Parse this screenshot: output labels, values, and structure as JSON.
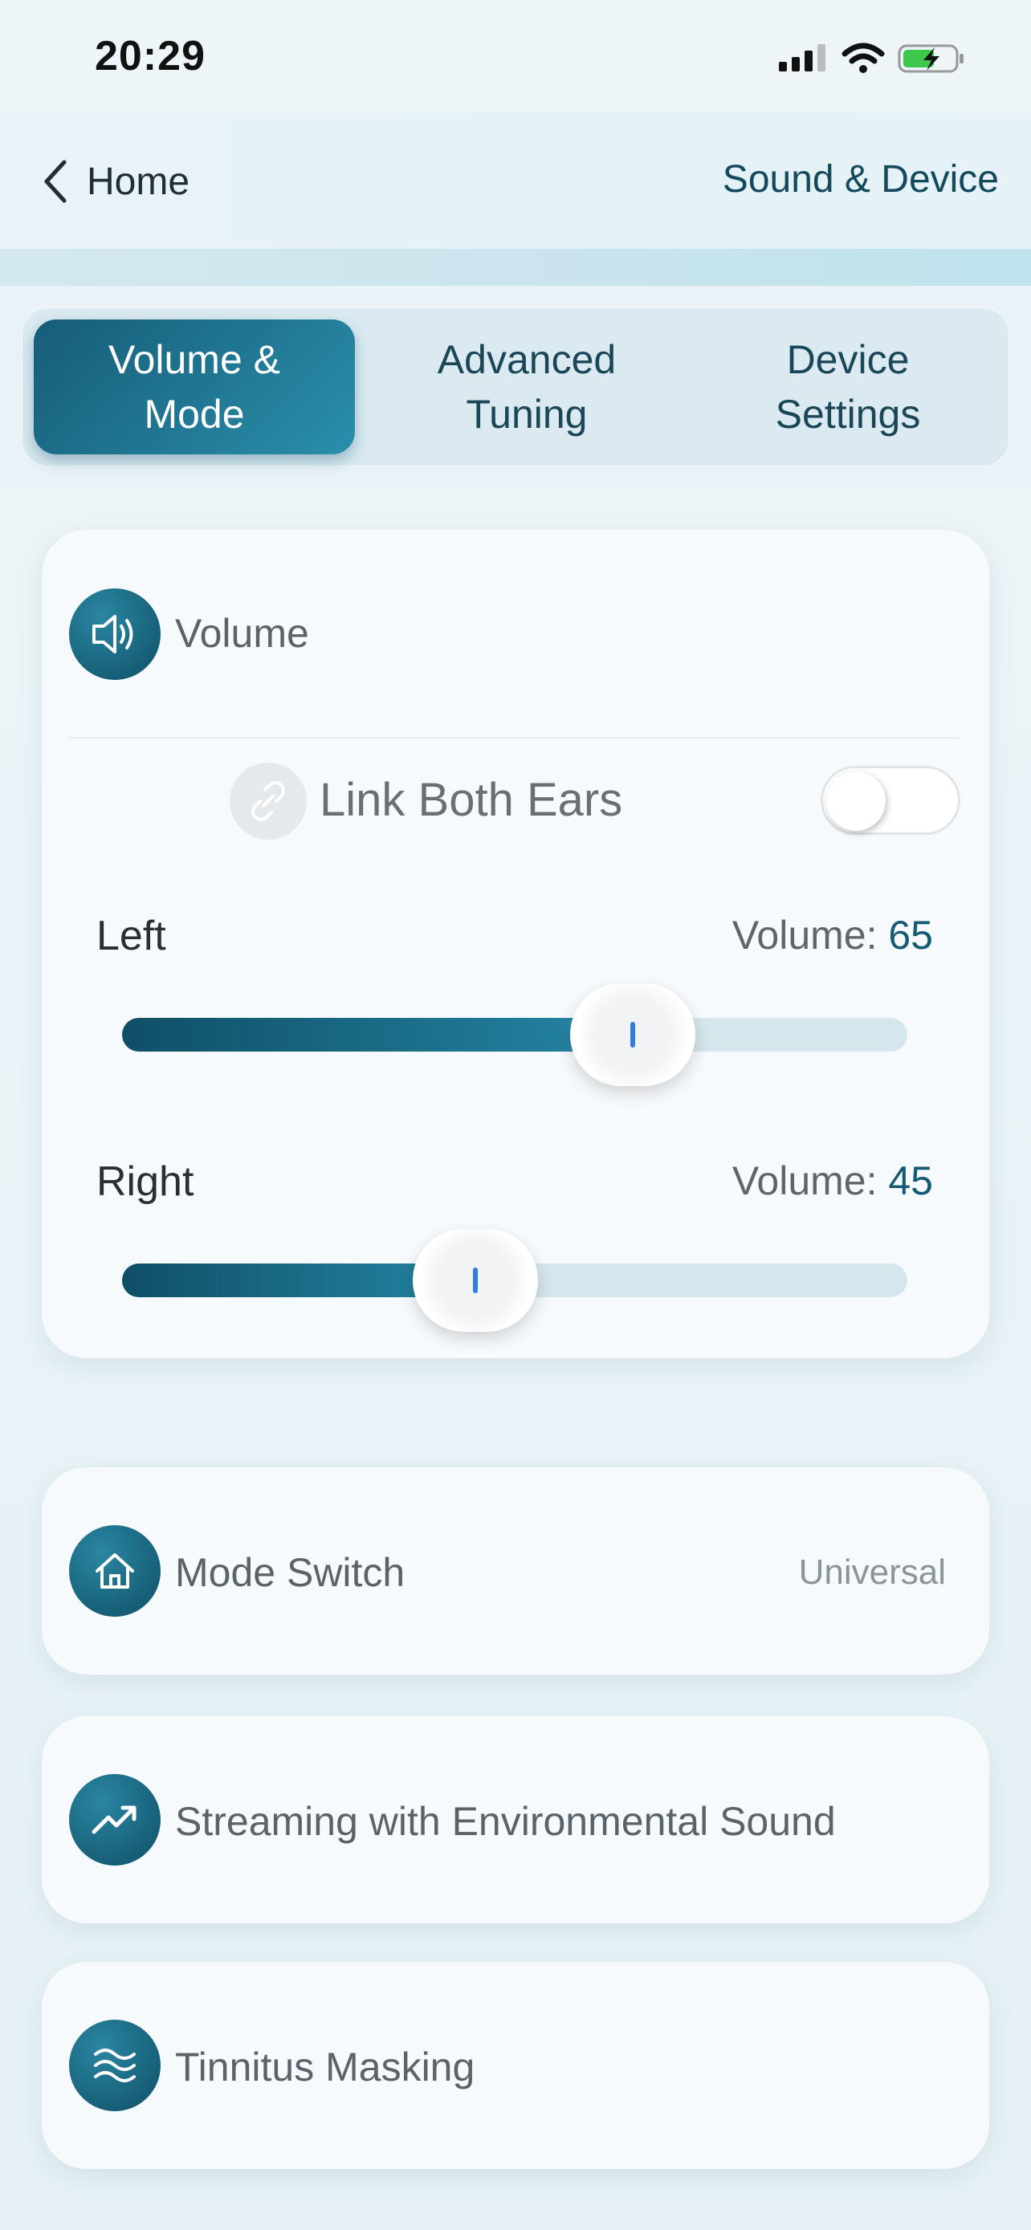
{
  "status_bar": {
    "time": "20:29",
    "battery_color": "#3cc84a"
  },
  "nav": {
    "back_label": "Home",
    "title": "Sound & Device"
  },
  "tabs": [
    {
      "label": "Volume &\nMode",
      "active": true
    },
    {
      "label": "Advanced\nTuning",
      "active": false
    },
    {
      "label": "Device\nSettings",
      "active": false
    }
  ],
  "volume_card": {
    "title": "Volume",
    "link_label": "Link Both Ears",
    "link_enabled": false,
    "left": {
      "label": "Left",
      "readout_prefix": "Volume: ",
      "value": "65",
      "level_percent": 65
    },
    "right": {
      "label": "Right",
      "readout_prefix": "Volume: ",
      "value": "45",
      "level_percent": 45
    }
  },
  "rows": {
    "mode": {
      "label": "Mode Switch",
      "value": "Universal",
      "icon": "home-icon"
    },
    "stream": {
      "label": "Streaming with Environmental Sound",
      "icon": "trend-icon"
    },
    "tinnitus": {
      "label": "Tinnitus Masking",
      "icon": "waves-icon"
    }
  },
  "colors": {
    "accent": "#155b74",
    "accent_light": "#2a8fab"
  }
}
